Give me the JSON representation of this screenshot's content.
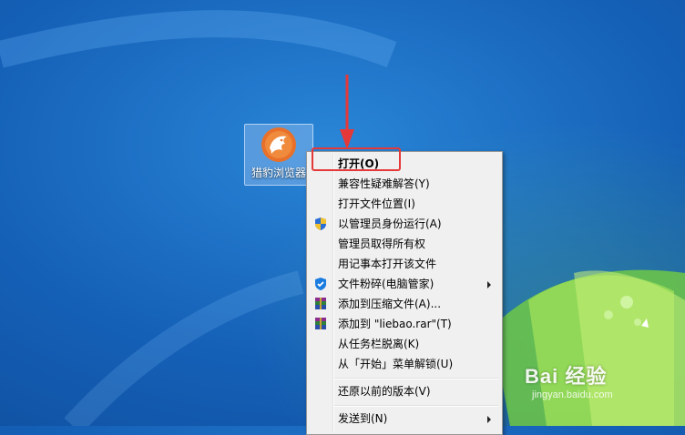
{
  "desktop": {
    "icon_label": "猎豹浏览器"
  },
  "context_menu": {
    "items": [
      {
        "label": "打开(O)",
        "bold": true,
        "icon": ""
      },
      {
        "label": "兼容性疑难解答(Y)",
        "icon": ""
      },
      {
        "label": "打开文件位置(I)",
        "icon": ""
      },
      {
        "label": "以管理员身份运行(A)",
        "icon": "uac-shield-icon"
      },
      {
        "label": "管理员取得所有权",
        "icon": ""
      },
      {
        "label": "用记事本打开该文件",
        "icon": ""
      },
      {
        "label": "文件粉碎(电脑管家)",
        "icon": "tencent-shield-icon",
        "submenu": true
      },
      {
        "label": "添加到压缩文件(A)...",
        "icon": "winrar-icon"
      },
      {
        "label": "添加到 \"liebao.rar\"(T)",
        "icon": "winrar-icon"
      },
      {
        "label": "从任务栏脱离(K)",
        "icon": ""
      },
      {
        "label": "从「开始」菜单解锁(U)",
        "icon": ""
      },
      {
        "label": "还原以前的版本(V)",
        "icon": ""
      },
      {
        "label": "发送到(N)",
        "icon": "",
        "submenu": true
      }
    ]
  },
  "annotation": {
    "highlight_color": "#e53939"
  },
  "watermark": {
    "main": "Bai 经验",
    "sub": "jingyan.baidu.com"
  }
}
